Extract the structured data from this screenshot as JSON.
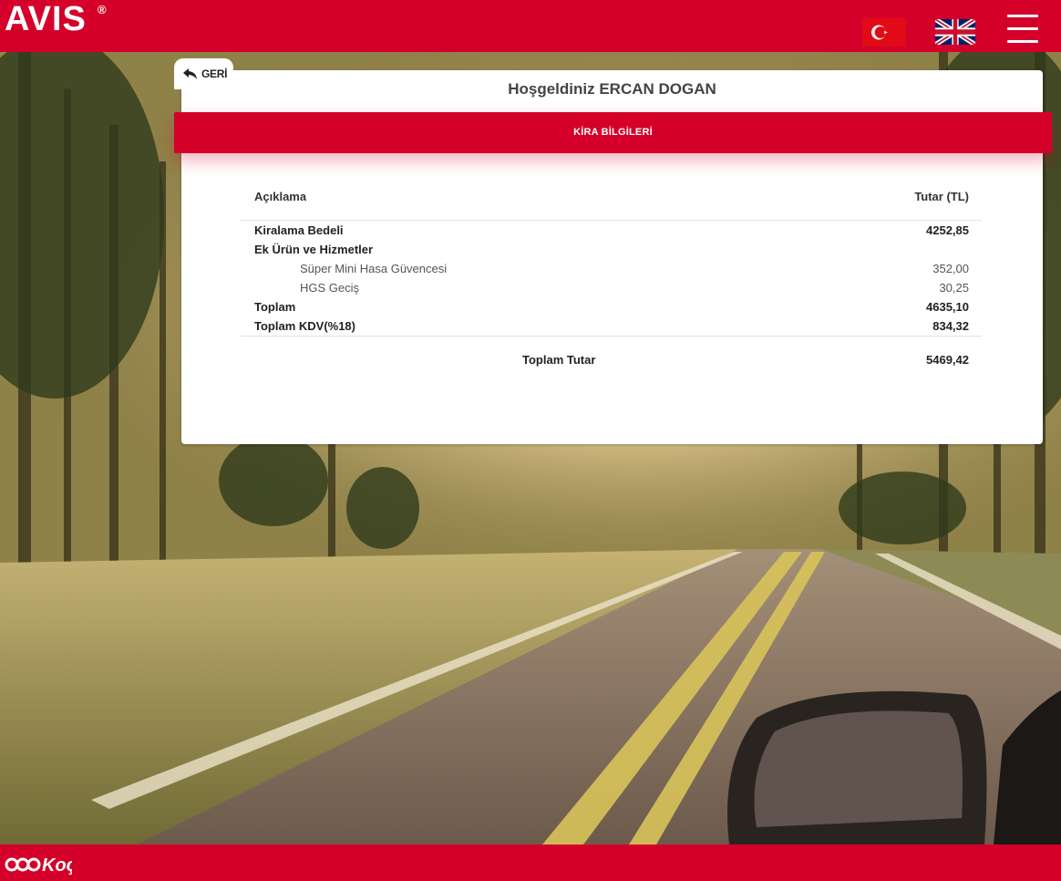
{
  "header": {
    "logo_text": "AVIS",
    "logo_reg": "®",
    "brand_color": "#d4002a"
  },
  "card": {
    "back_label": "GERİ",
    "welcome": "Hoşgeldiniz ERCAN DOGAN",
    "section_title": "KİRA BİLGİLERİ"
  },
  "table": {
    "col_description": "Açıklama",
    "col_amount": "Tutar (TL)",
    "rows": [
      {
        "label": "Kiralama Bedeli",
        "value": "4252,85"
      },
      {
        "label": "Ek Ürün ve Hizmetler",
        "value": ""
      },
      {
        "label": "Süper Mini Hasa Güvencesi",
        "value": "352,00"
      },
      {
        "label": "HGS Geciş",
        "value": "30,25"
      },
      {
        "label": "Toplam",
        "value": "4635,10"
      },
      {
        "label": "Toplam KDV(%18)",
        "value": "834,32"
      }
    ],
    "total_label": "Toplam Tutar",
    "total_value": "5469,42"
  },
  "icons": {
    "flag_tr": "turkey-flag-icon",
    "flag_uk": "uk-flag-icon",
    "menu": "hamburger-menu-icon",
    "back": "reply-arrow-icon",
    "footer_logo": "koc-logo-icon"
  }
}
